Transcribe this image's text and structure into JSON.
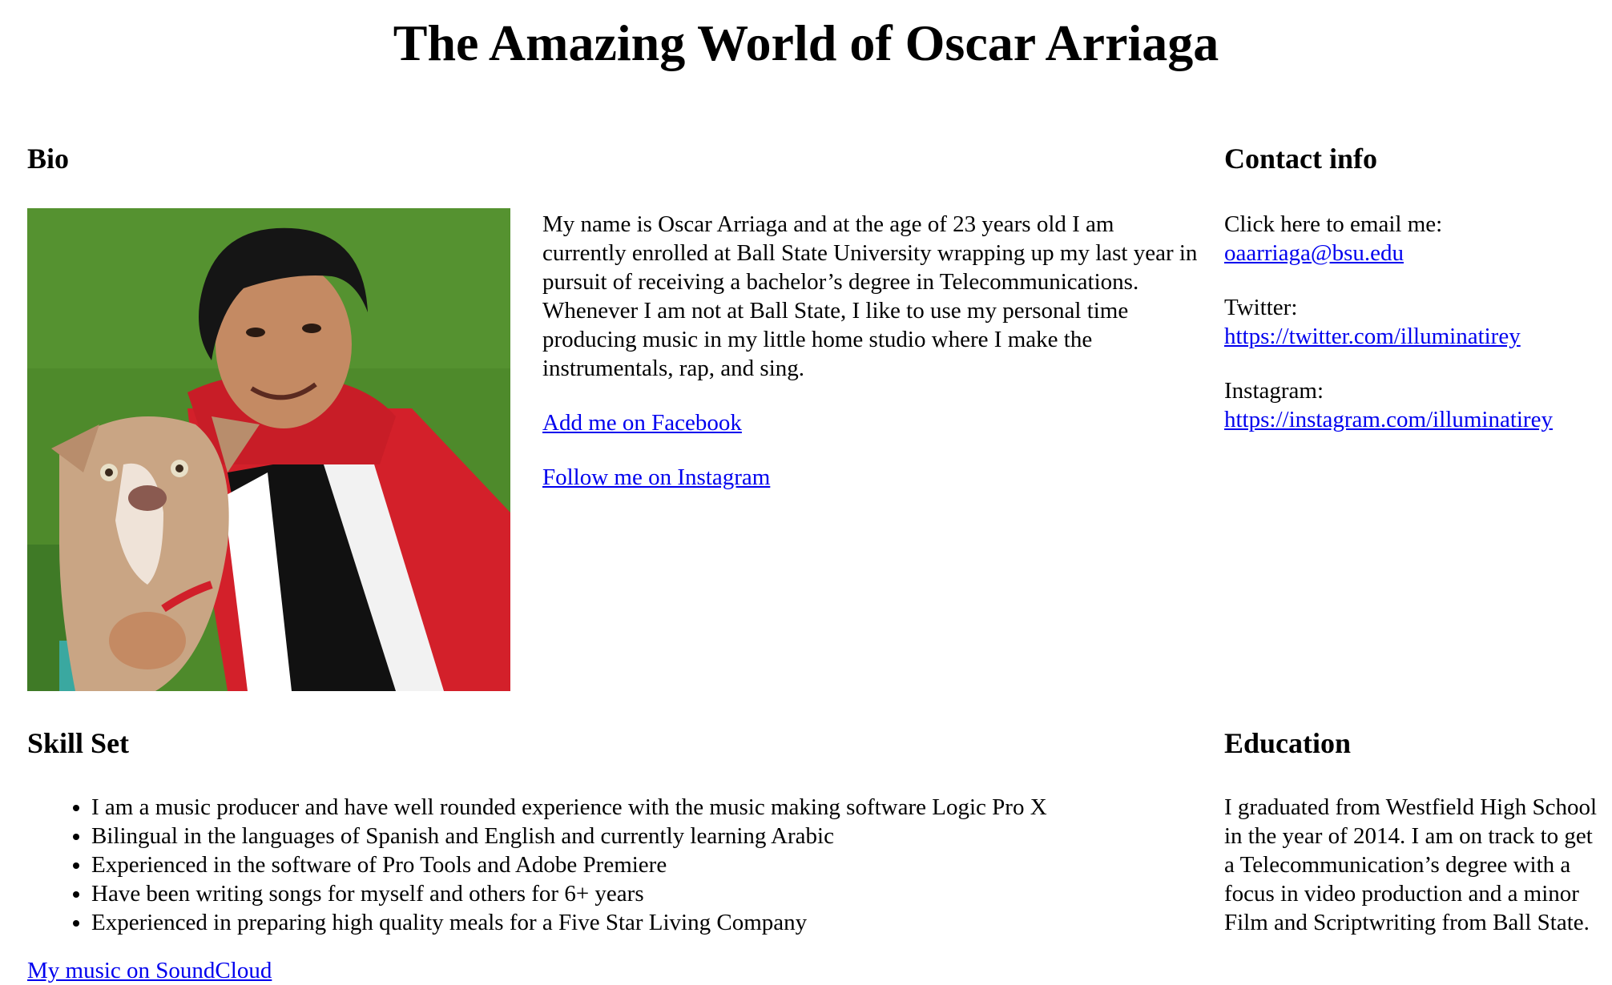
{
  "page": {
    "title": "The Amazing World of Oscar Arriaga"
  },
  "bio": {
    "heading": "Bio",
    "paragraph": "My name is Oscar Arriaga and at the age of 23 years old I am currently enrolled at Ball State University wrapping up my last year in pursuit of receiving a bachelor’s degree in Telecommunications. Whenever I am not at Ball State, I like to use my personal time producing music in my little home studio where I make the instrumentals, rap, and sing.",
    "facebook_link": "Add me on Facebook",
    "instagram_link": "Follow me on Instagram"
  },
  "contact": {
    "heading": "Contact info",
    "email_label": "Click here to email me:",
    "email": "oaarriaga@bsu.edu",
    "twitter_label": "Twitter:",
    "twitter_url": "https://twitter.com/illuminatirey",
    "instagram_label": "Instagram:",
    "instagram_url": "https://instagram.com/illuminatirey"
  },
  "skills": {
    "heading": "Skill Set",
    "items": [
      "I am a music producer and have well rounded experience with the music making software Logic Pro X",
      "Bilingual in the languages of Spanish and English and currently learning Arabic",
      "Experienced in the software of Pro Tools and Adobe Premiere",
      "Have been writing songs for myself and others for 6+ years",
      "Experienced in preparing high quality meals for a Five Star Living Company"
    ],
    "soundcloud_link": "My music on SoundCloud"
  },
  "education": {
    "heading": "Education",
    "paragraph": "I graduated from Westfield High School in the year of 2014. I am on track to get a Telecommunication’s degree with a focus in video production and a minor Film and Scriptwriting from Ball State."
  },
  "colors": {
    "link": "#0000ee",
    "text": "#000000",
    "background": "#ffffff"
  }
}
